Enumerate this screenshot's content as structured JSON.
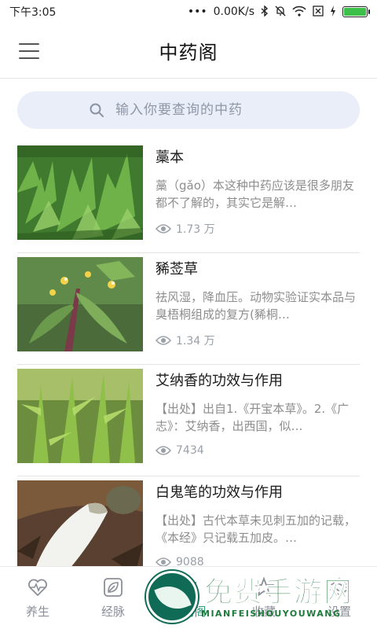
{
  "status_bar": {
    "time": "下午3:05",
    "dots": "•••",
    "speed": "0.00K/s"
  },
  "header": {
    "title": "中药阁"
  },
  "search": {
    "placeholder": "输入你要查询的中药"
  },
  "items": [
    {
      "title": "藁本",
      "desc": "藁（gǎo）本这种中药应该是很多朋友都不了解的，其实它是解…",
      "views": "1.73 万",
      "image": "herb-ligusticum"
    },
    {
      "title": "豨莶草",
      "desc": "祛风湿，降血压。动物实验证实本品与臭梧桐组成的复方(豨桐…",
      "views": "1.34 万",
      "image": "herb-siegesbeckia"
    },
    {
      "title": "艾纳香的功效与作用",
      "desc": "【出处】出自1.《开宝本草》。2.《广志》：艾纳香，出西国，似…",
      "views": "7434",
      "image": "herb-blumea"
    },
    {
      "title": "白鬼笔的功效与作用",
      "desc": "【出处】古代本草未见刺五加的记载，《本经》只记载五加皮。…",
      "views": "9088",
      "image": "herb-phallus"
    }
  ],
  "bottom_nav": [
    {
      "label": "养生",
      "icon": "heart-pulse-icon",
      "active": false
    },
    {
      "label": "经脉",
      "icon": "leaf-icon",
      "active": false
    },
    {
      "label": "中药阁",
      "icon": "herb-icon",
      "active": true
    },
    {
      "label": "收藏",
      "icon": "star-icon",
      "active": false
    },
    {
      "label": "设置",
      "icon": "gear-icon",
      "active": false
    }
  ],
  "watermark": {
    "text": "免费手游网",
    "sub": "MIANFEISHOUYOUWANG"
  },
  "colors": {
    "accent": "#2e9c7a",
    "search_bg": "#e9eef8",
    "battery": "#3cc04a"
  }
}
